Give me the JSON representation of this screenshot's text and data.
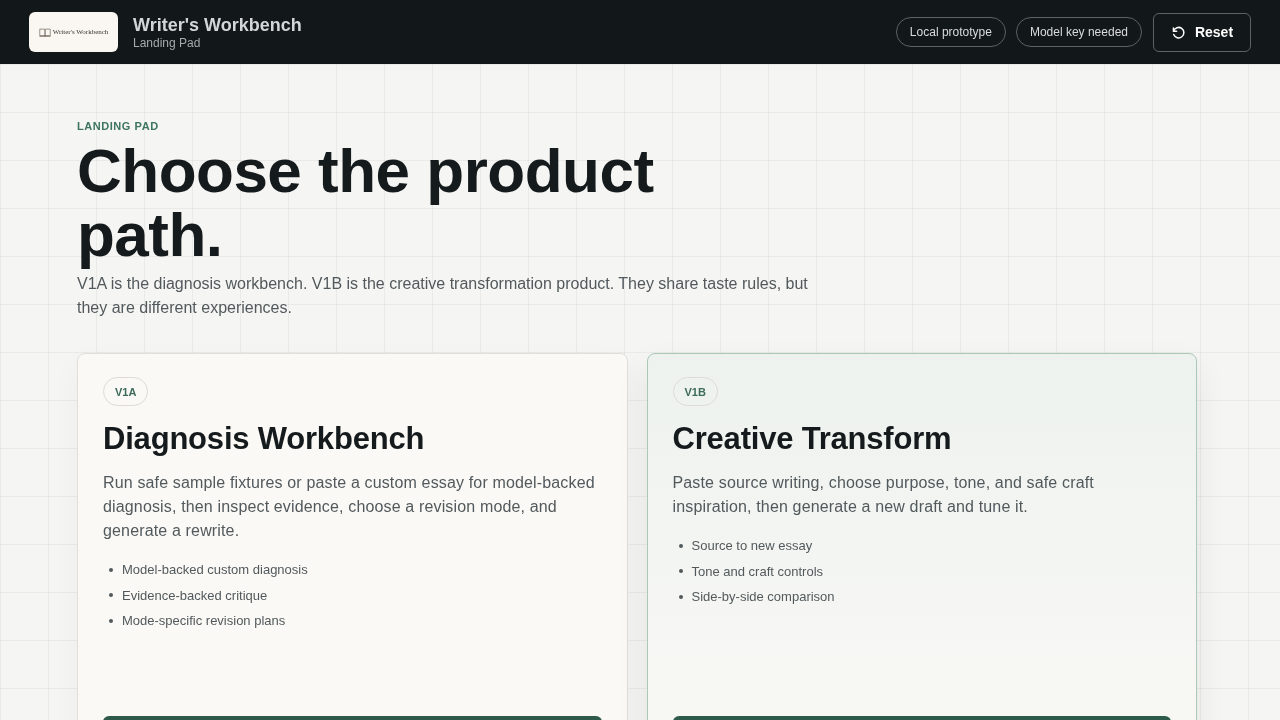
{
  "header": {
    "logo": {
      "text": "Writer's Workbench"
    },
    "title": "Writer's Workbench",
    "subtitle": "Landing Pad",
    "status_pills": [
      "Local prototype",
      "Model key needed"
    ],
    "reset_button": {
      "label": "Reset"
    }
  },
  "hero": {
    "eyebrow": "LANDING PAD",
    "heading": "Choose the product path.",
    "intro": "V1A is the diagnosis workbench. V1B is the creative transformation product. They share taste rules, but they are different experiences."
  },
  "cards": [
    {
      "badge": "V1A",
      "title": "Diagnosis Workbench",
      "description": "Run safe sample fixtures or paste a custom essay for model-backed diagnosis, then inspect evidence, choose a revision mode, and generate a rewrite.",
      "features": [
        "Model-backed custom diagnosis",
        "Evidence-backed critique",
        "Mode-specific revision plans"
      ],
      "selected": false
    },
    {
      "badge": "V1B",
      "title": "Creative Transform",
      "description": "Paste source writing, choose purpose, tone, and safe craft inspiration, then generate a new draft and tune it.",
      "features": [
        "Source to new essay",
        "Tone and craft controls",
        "Side-by-side comparison"
      ],
      "selected": true
    }
  ]
}
